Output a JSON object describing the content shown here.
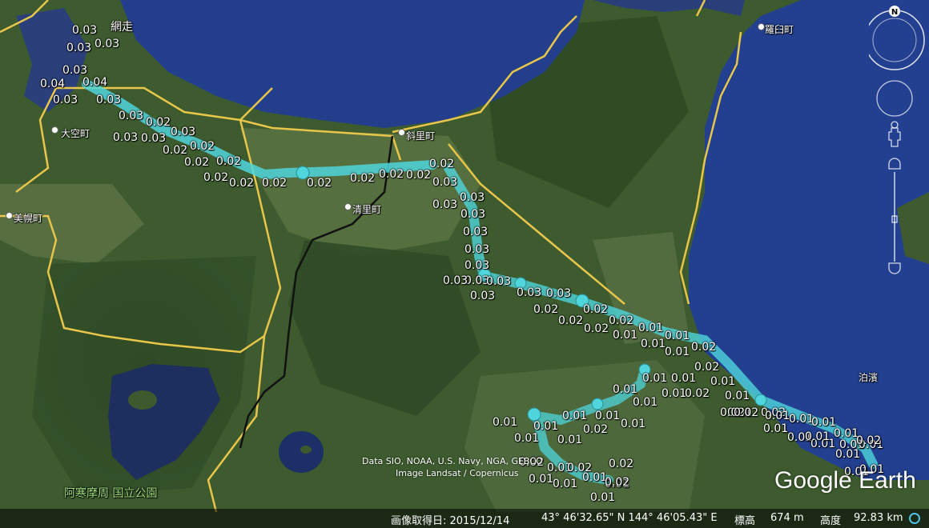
{
  "places": [
    {
      "name": "網走",
      "dot": false
    },
    {
      "name": "大空町",
      "dot": true
    },
    {
      "name": "斜里町",
      "dot": true
    },
    {
      "name": "清里町",
      "dot": true
    },
    {
      "name": "美幌町",
      "dot": true
    },
    {
      "name": "羅臼町",
      "dot": true
    },
    {
      "name": "泊濱",
      "dot": false
    }
  ],
  "park_label": "阿寒摩周 国立公園",
  "values": [
    "0.03",
    "0.03",
    "0.03",
    "0.03",
    "0.04",
    "0.04",
    "0.03",
    "0.03",
    "0.03",
    "0.02",
    "0.03",
    "0.03",
    "0.03",
    "0.02",
    "0.02",
    "0.02",
    "0.02",
    "0.02",
    "0.02",
    "0.02",
    "0.02",
    "0.02",
    "0.02",
    "0.02",
    "0.02",
    "0.03",
    "0.03",
    "0.03",
    "0.03",
    "0.03",
    "0.03",
    "0.03",
    "0.03",
    "0.03",
    "0.03",
    "0.03",
    "0.03",
    "0.03",
    "0.02",
    "0.02",
    "0.02",
    "0.02",
    "0.02",
    "0.01",
    "0.01",
    "0.01",
    "0.01",
    "0.01",
    "0.02",
    "0.02",
    "0.01",
    "0.01",
    "0.01",
    "0.01",
    "0.01",
    "0.02",
    "0.01",
    "0.01",
    "0.01",
    "0.02",
    "0.02",
    "0.01",
    "0.01",
    "0.01",
    "0.01",
    "0.01",
    "0.01",
    "0.01",
    "0.01",
    "0.01",
    "0.01",
    "0.02",
    "0.01",
    "0.01",
    "0.01",
    "0.02",
    "0.01",
    "0.01",
    "0.01",
    "0.01",
    "0.01",
    "0.01",
    "0.01",
    "0.01",
    "0.01",
    "0.01",
    "0.02",
    "0.02",
    "0.02",
    "0.01",
    "0.02",
    "0.02",
    "0.01",
    "0.01"
  ],
  "attribution": [
    "Data SIO, NOAA, U.S. Navy, NGA, GEBCO",
    "Image Landsat / Copernicus"
  ],
  "logo": "Google Earth",
  "status": {
    "date_label": "画像取得日: 2015/12/14",
    "coords": "43° 46'32.65\" N 144° 46'05.43\" E",
    "elev_label": "標高",
    "elev_value": "674 m",
    "alt_label": "高度",
    "alt_value": "92.83 km"
  },
  "compass_letter": "N",
  "colors": {
    "marker": "#4fd6dc",
    "road": "#e8c64a",
    "sea": "#1f3f8e",
    "land": "#3b5a2c"
  }
}
